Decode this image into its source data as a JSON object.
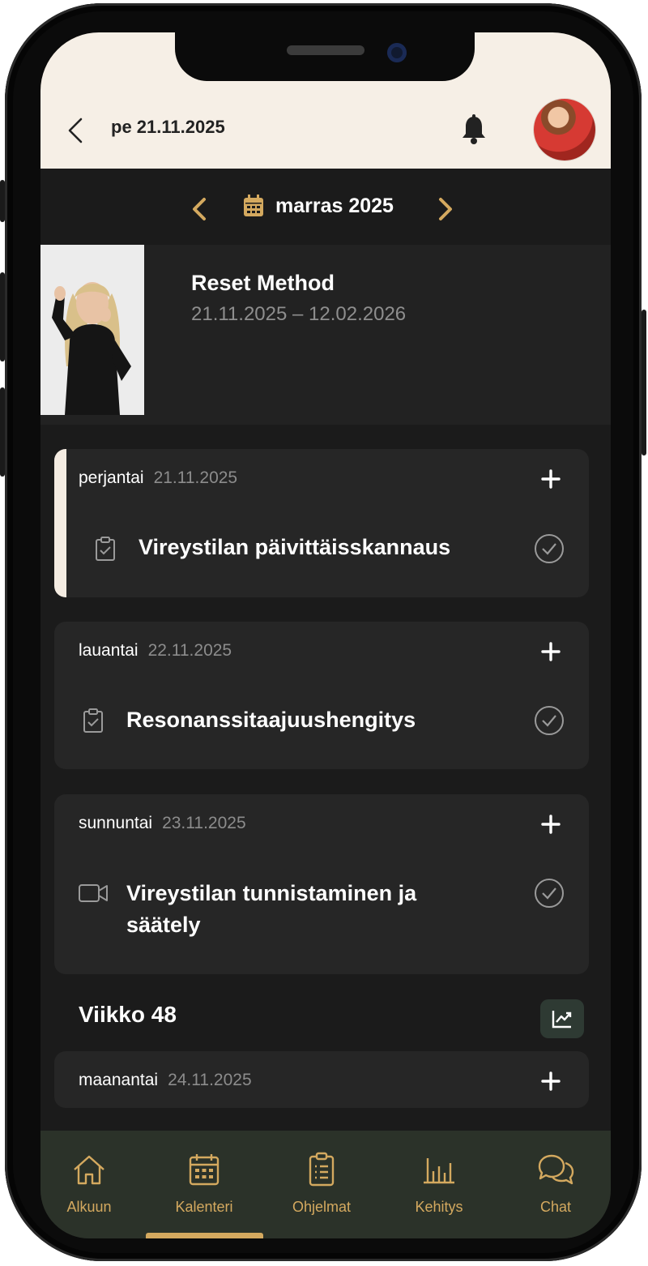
{
  "header": {
    "date_title": "pe 21.11.2025"
  },
  "month_nav": {
    "label": "marras 2025"
  },
  "program": {
    "name": "Reset Method",
    "dates": "21.11.2025 – 12.02.2026"
  },
  "days": [
    {
      "weekday": "perjantai",
      "date": "21.11.2025",
      "task": "Vireystilan päivittäisskannaus",
      "task_icon": "clipboard-check-icon",
      "today": true
    },
    {
      "weekday": "lauantai",
      "date": "22.11.2025",
      "task": "Resonanssitaajuushengitys",
      "task_icon": "clipboard-check-icon"
    },
    {
      "weekday": "sunnuntai",
      "date": "23.11.2025",
      "task": "Vireystilan tunnistaminen ja säätely",
      "task_icon": "video-icon"
    }
  ],
  "week": {
    "title": "Viikko 48"
  },
  "next_day": {
    "weekday": "maanantai",
    "date": "24.11.2025"
  },
  "tabs": [
    {
      "label": "Alkuun",
      "icon": "home-icon"
    },
    {
      "label": "Kalenteri",
      "icon": "calendar-icon",
      "active": true
    },
    {
      "label": "Ohjelmat",
      "icon": "clipboard-list-icon"
    },
    {
      "label": "Kehitys",
      "icon": "bar-chart-icon"
    },
    {
      "label": "Chat",
      "icon": "chat-bubbles-icon"
    }
  ],
  "colors": {
    "accent": "#d4a95f",
    "header_bg": "#f6efe6",
    "card_bg": "#262626",
    "tabbar_bg": "#2b3229"
  }
}
